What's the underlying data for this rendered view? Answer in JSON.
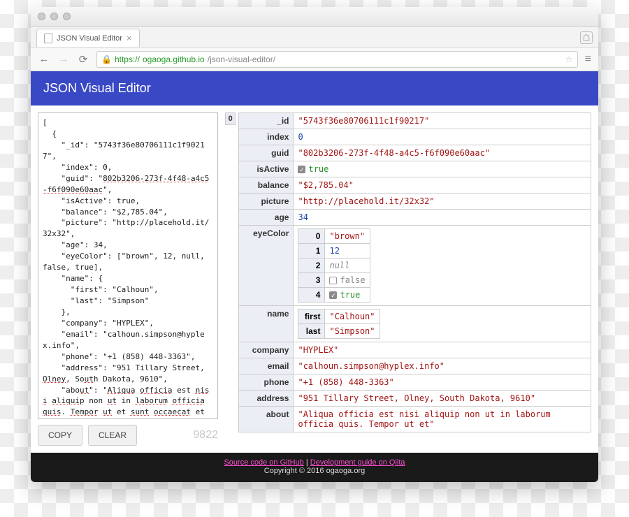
{
  "browser": {
    "tab_title": "JSON Visual Editor",
    "url_scheme": "https://",
    "url_host": "ogaoga.github.io",
    "url_path": "/json-visual-editor/"
  },
  "app": {
    "title": "JSON Visual Editor"
  },
  "raw_json_text": "[\n  {\n    \"_id\": \"5743f36e80706111c1f90217\",\n    \"index\": 0,\n    \"guid\": \"802b3206-273f-4f48-a4c5-f6f090e60aac\",\n    \"isActive\": true,\n    \"balance\": \"$2,785.04\",\n    \"picture\": \"http://placehold.it/32x32\",\n    \"age\": 34,\n    \"eyeColor\": [\"brown\", 12, null, false, true],\n    \"name\": {\n      \"first\": \"Calhoun\",\n      \"last\": \"Simpson\"\n    },\n    \"company\": \"HYPLEX\",\n    \"email\": \"calhoun.simpson@hyplex.info\",\n    \"phone\": \"+1 (858) 448-3363\",\n    \"address\": \"951 Tillary Street, Olney, South Dakota, 9610\",\n    \"about\": \"Aliqua officia est nisi aliquip non ut in laborum officia quis. Tempor ut et sunt occaecat et non. Est irure dolor et dolore voluptate veniam irure velit cupidatat ut aliquip nisi deserunt",
  "controls": {
    "copy": "COPY",
    "clear": "CLEAR",
    "char_count": "9822"
  },
  "visual": {
    "array_index": "0",
    "fields": {
      "_id": "5743f36e80706111c1f90217",
      "index": 0,
      "guid": "802b3206-273f-4f48-a4c5-f6f090e60aac",
      "isActive": true,
      "balance": "$2,785.04",
      "picture": "http://placehold.it/32x32",
      "age": 34,
      "eyeColor": [
        "brown",
        12,
        null,
        false,
        true
      ],
      "name": {
        "first": "Calhoun",
        "last": "Simpson"
      },
      "company": "HYPLEX",
      "email": "calhoun.simpson@hyplex.info",
      "phone": "+1 (858) 448-3363",
      "address": "951 Tillary Street, Olney, South Dakota, 9610",
      "about": "Aliqua officia est nisi aliquip non ut in laborum officia quis. Tempor ut et"
    },
    "labels": {
      "_id": "_id",
      "index": "index",
      "guid": "guid",
      "isActive": "isActive",
      "balance": "balance",
      "picture": "picture",
      "age": "age",
      "eyeColor": "eyeColor",
      "name": "name",
      "company": "company",
      "email": "email",
      "phone": "phone",
      "address": "address",
      "about": "about",
      "first": "first",
      "last": "last",
      "idx0": "0",
      "idx1": "1",
      "idx2": "2",
      "idx3": "3",
      "idx4": "4",
      "true": "true",
      "false": "false",
      "null": "null"
    }
  },
  "footer": {
    "link1": "Source code on GitHub",
    "link2": "Development guide on Qiita",
    "sep": " | ",
    "copyright": "Copyright © 2016 ogaoga.org"
  }
}
